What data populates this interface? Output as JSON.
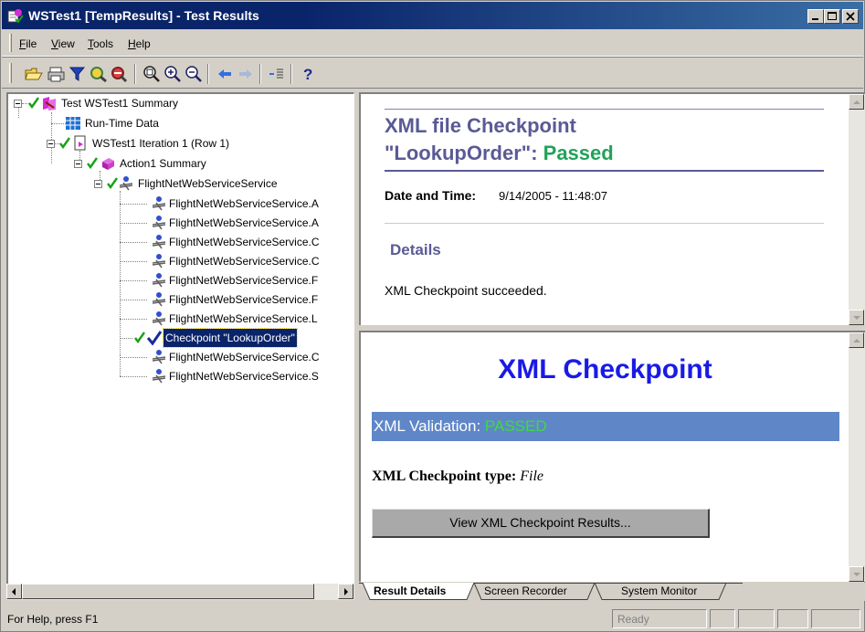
{
  "window": {
    "title": "WSTest1 [TempResults] - Test Results",
    "controls": [
      "minimize-icon",
      "maximize-icon",
      "close-icon"
    ]
  },
  "menu": {
    "items": [
      {
        "label": "File",
        "accel": "F",
        "rest": "ile"
      },
      {
        "label": "View",
        "accel": "V",
        "rest": "iew"
      },
      {
        "label": "Tools",
        "accel": "T",
        "rest": "ools"
      },
      {
        "label": "Help",
        "accel": "H",
        "rest": "elp"
      }
    ]
  },
  "toolbar": {
    "icons": [
      "open-icon",
      "print-icon",
      "filter-icon",
      "find-icon",
      "find-next-icon",
      "zoom-fit-icon",
      "zoom-in-icon",
      "zoom-out-icon",
      "back-arrow-icon",
      "forward-arrow-icon",
      "expand-all-icon",
      "help-icon"
    ]
  },
  "tree": {
    "nodes": [
      {
        "label": "Test WSTest1 Summary",
        "passed": true,
        "icon": "test-summary-icon"
      },
      {
        "label": "Run-Time Data",
        "passed": false,
        "icon": "data-table-icon"
      },
      {
        "label": "WSTest1 Iteration 1 (Row 1)",
        "passed": true,
        "icon": "iteration-icon"
      },
      {
        "label": "Action1 Summary",
        "passed": true,
        "icon": "action-icon"
      },
      {
        "label": "FlightNetWebServiceService",
        "passed": true,
        "icon": "web-service-icon"
      },
      {
        "label": "FlightNetWebServiceService.A",
        "passed": false,
        "icon": "web-service-icon"
      },
      {
        "label": "FlightNetWebServiceService.A",
        "passed": false,
        "icon": "web-service-icon"
      },
      {
        "label": "FlightNetWebServiceService.C",
        "passed": false,
        "icon": "web-service-icon"
      },
      {
        "label": "FlightNetWebServiceService.C",
        "passed": false,
        "icon": "web-service-icon"
      },
      {
        "label": "FlightNetWebServiceService.F",
        "passed": false,
        "icon": "web-service-icon"
      },
      {
        "label": "FlightNetWebServiceService.F",
        "passed": false,
        "icon": "web-service-icon"
      },
      {
        "label": "FlightNetWebServiceService.L",
        "passed": false,
        "icon": "web-service-icon"
      },
      {
        "label": "Checkpoint \"LookupOrder\"",
        "passed": true,
        "icon": "checkpoint-icon",
        "selected": true
      },
      {
        "label": "FlightNetWebServiceService.C",
        "passed": false,
        "icon": "web-service-icon"
      },
      {
        "label": "FlightNetWebServiceService.S",
        "passed": false,
        "icon": "web-service-icon"
      }
    ]
  },
  "summary": {
    "heading_line1": "XML file Checkpoint",
    "heading_line2_prefix": "\"LookupOrder\": ",
    "status": "Passed",
    "date_label": "Date and Time:",
    "date_value": " 9/14/2005 - 11:48:07",
    "details_heading": "Details",
    "details_text": "XML Checkpoint succeeded."
  },
  "xml_checkpoint": {
    "title": "XML Checkpoint",
    "validation_label": "XML Validation: ",
    "validation_status": "PASSED",
    "type_label": "XML Checkpoint type:",
    "type_value": "File",
    "view_button": "View XML Checkpoint Results..."
  },
  "tabs": [
    {
      "label": "Result Details",
      "active": true
    },
    {
      "label": "Screen Recorder",
      "active": false
    },
    {
      "label": "System Monitor",
      "active": false
    }
  ],
  "statusbar": {
    "help": "For Help, press F1",
    "ready": "Ready"
  },
  "colors": {
    "titlebar": "#0a246a",
    "heading": "#5a5a96",
    "passed_green": "#21a35a",
    "xml_title_blue": "#1a1ae6",
    "validation_bar": "#5f87c8",
    "validation_passed": "#3cdc3c",
    "selection": "#0a246a"
  }
}
